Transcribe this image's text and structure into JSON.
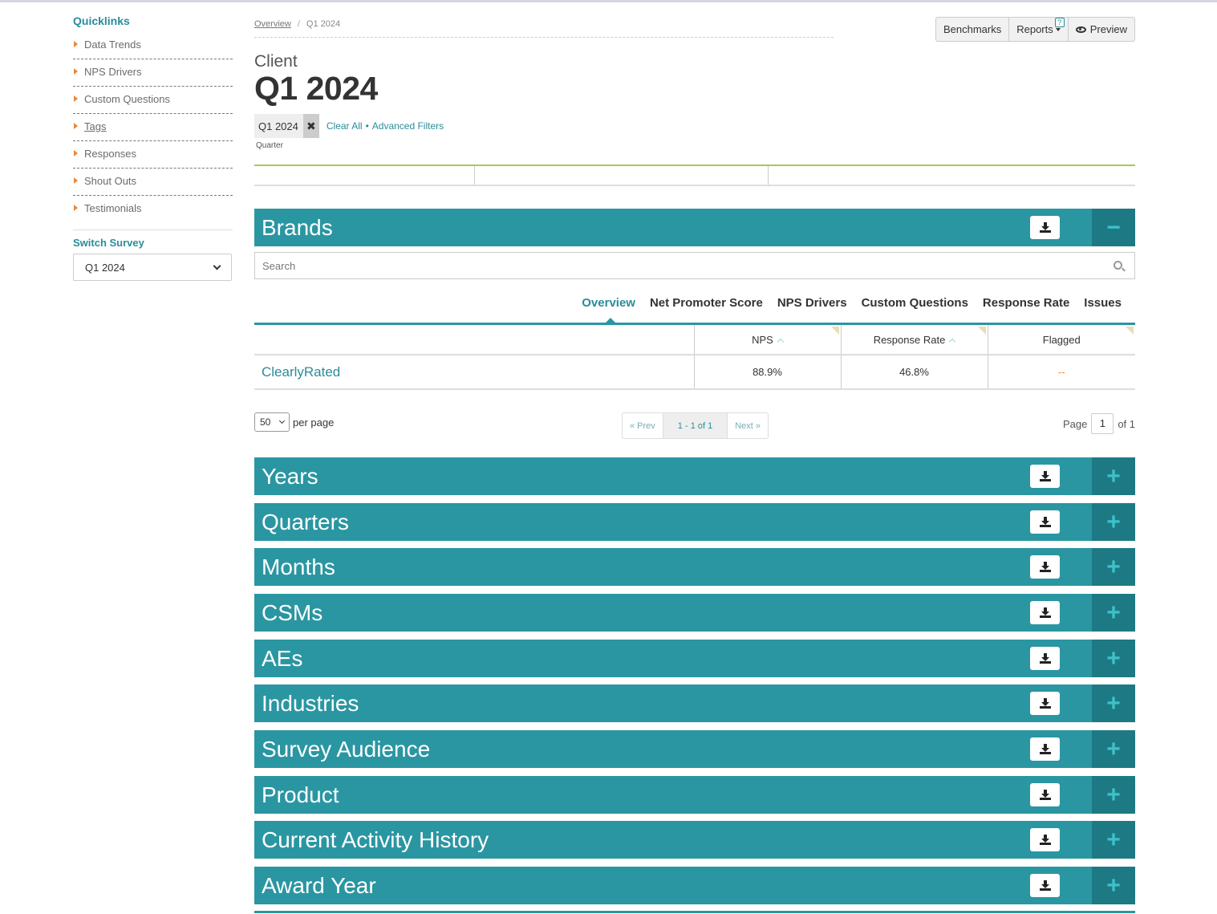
{
  "sidebar": {
    "quicklinks_title": "Quicklinks",
    "items": [
      {
        "label": "Data Trends"
      },
      {
        "label": "NPS Drivers"
      },
      {
        "label": "Custom Questions"
      },
      {
        "label": "Tags"
      },
      {
        "label": "Responses"
      },
      {
        "label": "Shout Outs"
      },
      {
        "label": "Testimonials"
      }
    ],
    "switch_survey_title": "Switch Survey",
    "switch_survey_value": "Q1 2024"
  },
  "breadcrumb": {
    "root": "Overview",
    "sep": "/",
    "current": "Q1 2024"
  },
  "toolbar": {
    "benchmarks": "Benchmarks",
    "reports": "Reports",
    "help": "?",
    "preview": "Preview"
  },
  "header": {
    "client": "Client",
    "title": "Q1 2024"
  },
  "filters": {
    "chip_label": "Q1 2024",
    "chip_remove": "✖",
    "chip_sub": "Quarter",
    "clear_all": "Clear All",
    "dot": "•",
    "advanced": "Advanced Filters"
  },
  "brands": {
    "title": "Brands",
    "toggle": "−",
    "search_placeholder": "Search",
    "tabs": [
      "Overview",
      "Net Promoter Score",
      "NPS Drivers",
      "Custom Questions",
      "Response Rate",
      "Issues"
    ],
    "columns": [
      "",
      "NPS",
      "Response Rate",
      "Flagged"
    ],
    "rows": [
      {
        "name": "ClearlyRated",
        "nps": "88.9%",
        "response_rate": "46.8%",
        "flagged": "--"
      }
    ]
  },
  "pagination": {
    "per_page_value": "50",
    "per_page_label": "per page",
    "prev": "« Prev",
    "range": "1 - 1 of 1",
    "next": "Next »",
    "page_label": "Page",
    "page_value": "1",
    "of_label": "of 1"
  },
  "sections": [
    {
      "title": "Years",
      "toggle": "+"
    },
    {
      "title": "Quarters",
      "toggle": "+"
    },
    {
      "title": "Months",
      "toggle": "+"
    },
    {
      "title": "CSMs",
      "toggle": "+"
    },
    {
      "title": "AEs",
      "toggle": "+"
    },
    {
      "title": "Industries",
      "toggle": "+"
    },
    {
      "title": "Survey Audience",
      "toggle": "+"
    },
    {
      "title": "Product",
      "toggle": "+"
    },
    {
      "title": "Current Activity History",
      "toggle": "+"
    },
    {
      "title": "Award Year",
      "toggle": "+"
    }
  ],
  "colors": {
    "teal": "#2a96a2",
    "teal_dark": "#1d7a84",
    "orange": "#e8883a",
    "green_rule": "#a8c75b"
  }
}
